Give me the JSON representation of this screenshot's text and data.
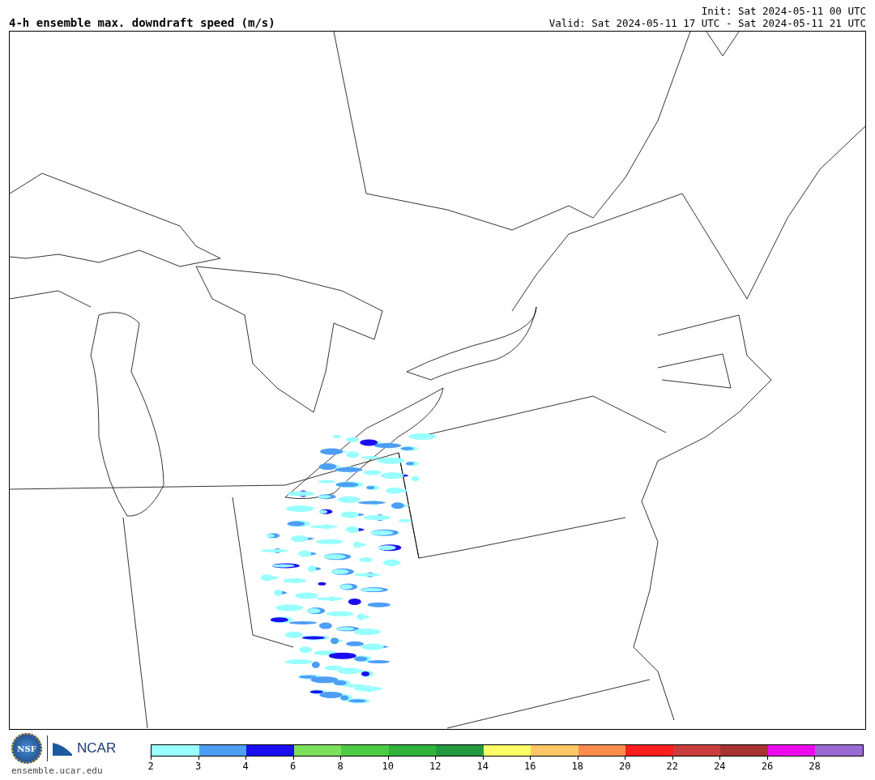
{
  "title": "4-h ensemble max. downdraft speed (m/s)",
  "init": "Init: Sat 2024-05-11 00 UTC",
  "valid": "Valid: Sat 2024-05-11 17 UTC - Sat 2024-05-11 21 UTC",
  "logo": {
    "nsf": "NSF",
    "ncar": "NCAR",
    "url": "ensemble.ucar.edu"
  },
  "colorbar": {
    "bins": [
      {
        "color": "#99ffff"
      },
      {
        "color": "#4e9ef5"
      },
      {
        "color": "#1a0df0"
      },
      {
        "color": "#7de05a"
      },
      {
        "color": "#4ccb45"
      },
      {
        "color": "#30b33a"
      },
      {
        "color": "#22993e"
      },
      {
        "color": "#ffff66"
      },
      {
        "color": "#ffc866"
      },
      {
        "color": "#ff8c4c"
      },
      {
        "color": "#ff1e1e"
      },
      {
        "color": "#cc3e3e"
      },
      {
        "color": "#a63232"
      },
      {
        "color": "#ec0aec"
      },
      {
        "color": "#9a6ad2"
      }
    ],
    "ticks": [
      "2",
      "3",
      "4",
      "6",
      "8",
      "10",
      "12",
      "14",
      "16",
      "18",
      "20",
      "22",
      "24",
      "26",
      "28"
    ]
  }
}
